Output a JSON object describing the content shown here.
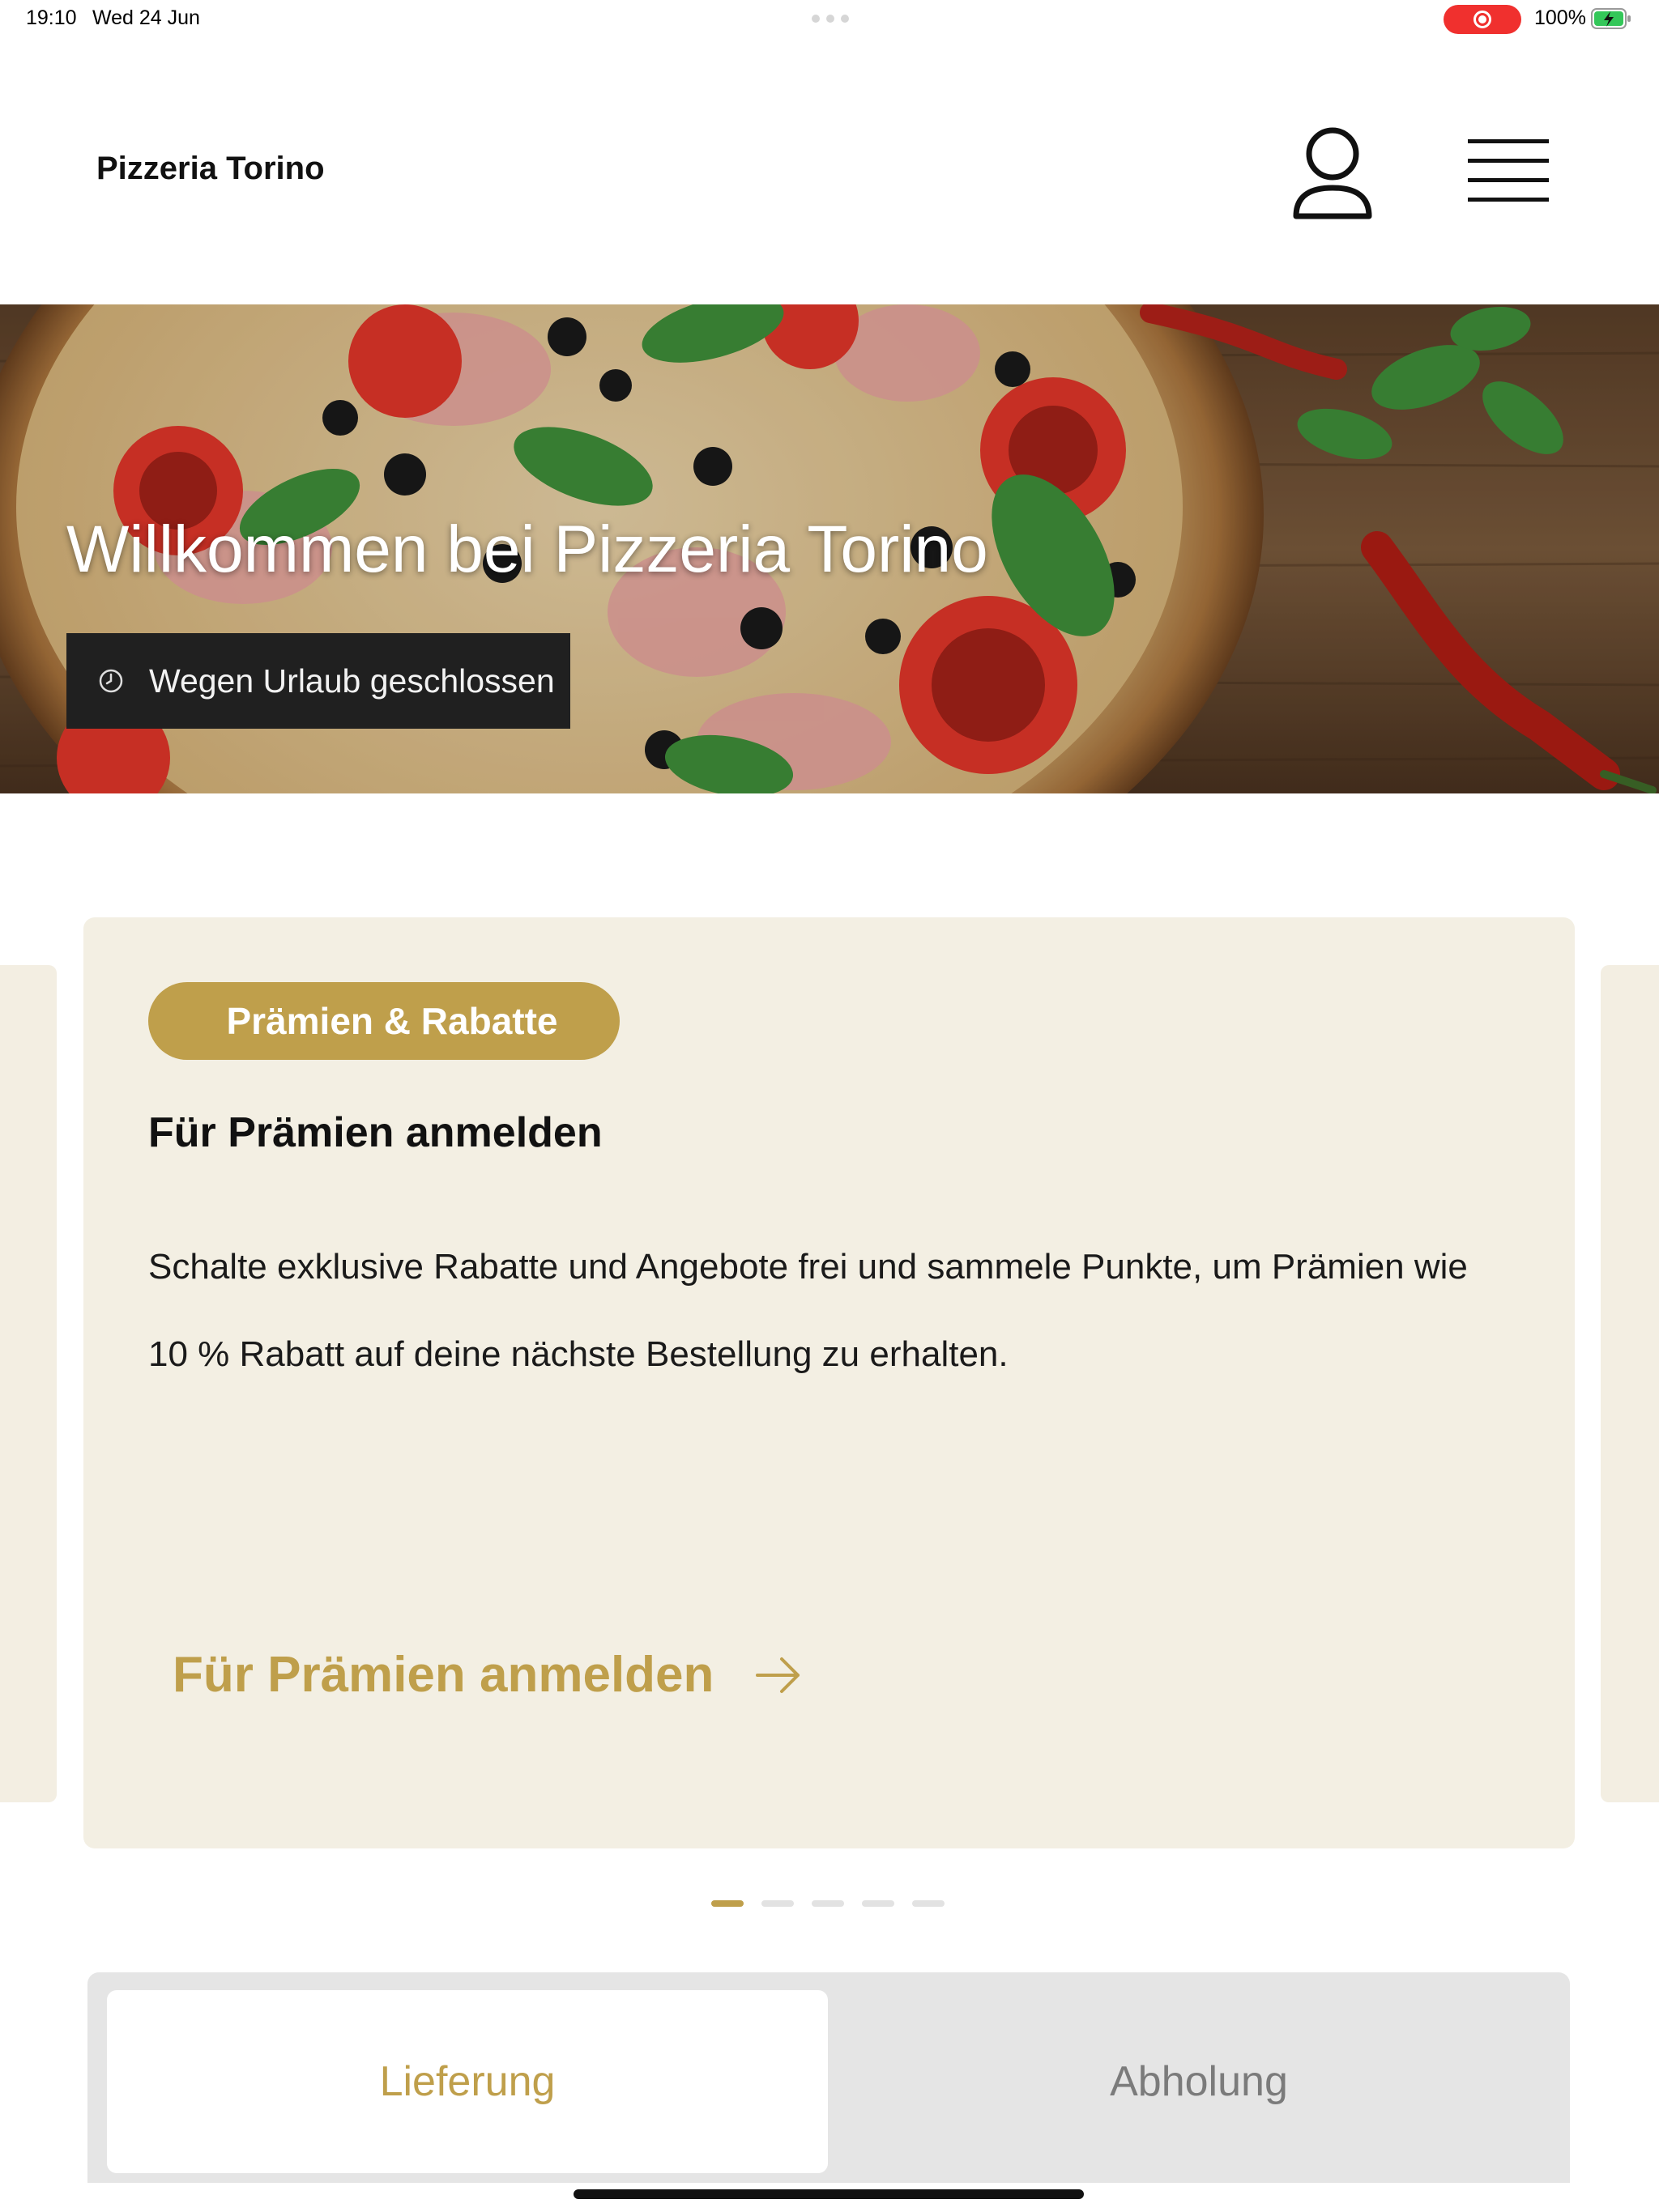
{
  "status_bar": {
    "time": "19:10",
    "date": "Wed 24 Jun",
    "battery_percent": "100%",
    "battery_level": 1.0,
    "recording_indicator_color": "#f0302e"
  },
  "header": {
    "brand": "Pizzeria Torino",
    "account_icon": "person-icon",
    "menu_icon": "hamburger-icon"
  },
  "hero": {
    "title": "Willkommen bei Pizzeria Torino",
    "status_text": "Wegen Urlaub geschlossen",
    "status_icon": "clock-icon"
  },
  "promo": {
    "tag": "Prämien & Rabatte",
    "heading": "Für Prämien anmelden",
    "body_line1": "Schalte exklusive Rabatte und Angebote frei und sammele Punkte, um Prämien wie",
    "body_line2": "10 % Rabatt auf deine nächste Bestellung zu erhalten.",
    "cta": "Für Prämien anmelden",
    "cta_icon": "arrow-right-icon"
  },
  "carousel": {
    "page_count": 5,
    "active_index": 0
  },
  "order_mode": {
    "options": [
      "Lieferung",
      "Abholung"
    ],
    "selected": "Lieferung"
  },
  "colors": {
    "accent": "#bf9f4b",
    "card_background": "#f3efe3",
    "badge_background": "#202020",
    "segment_background": "#e5e5e5"
  }
}
